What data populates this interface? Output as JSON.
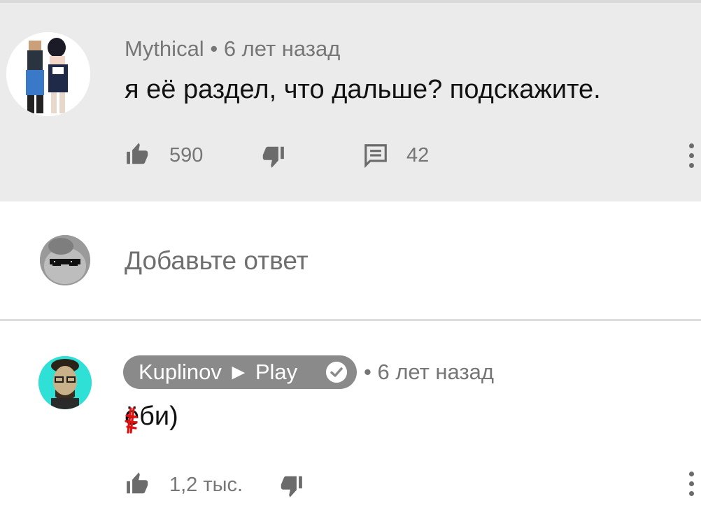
{
  "top_comment": {
    "author": "Mythical",
    "separator": "•",
    "time": "6 лет назад",
    "text": "я её раздел, что дальше? подскажите.",
    "likes": "590",
    "replies": "42"
  },
  "reply_box": {
    "placeholder": "Добавьте ответ"
  },
  "reply": {
    "author_badge": "Kuplinov ► Play",
    "time": "• 6 лет назад",
    "text": "ёби)",
    "likes": "1,2 тыс."
  },
  "icons": {
    "like": "thumbs-up-icon",
    "dislike": "thumbs-down-icon",
    "reply": "comment-icon",
    "more": "more-vertical-icon",
    "verified": "verified-check-icon"
  },
  "colors": {
    "highlight_bg": "#ebebeb",
    "badge_bg": "#8a8a8a",
    "text_secondary": "#767676",
    "red_mark": "#e01010"
  }
}
